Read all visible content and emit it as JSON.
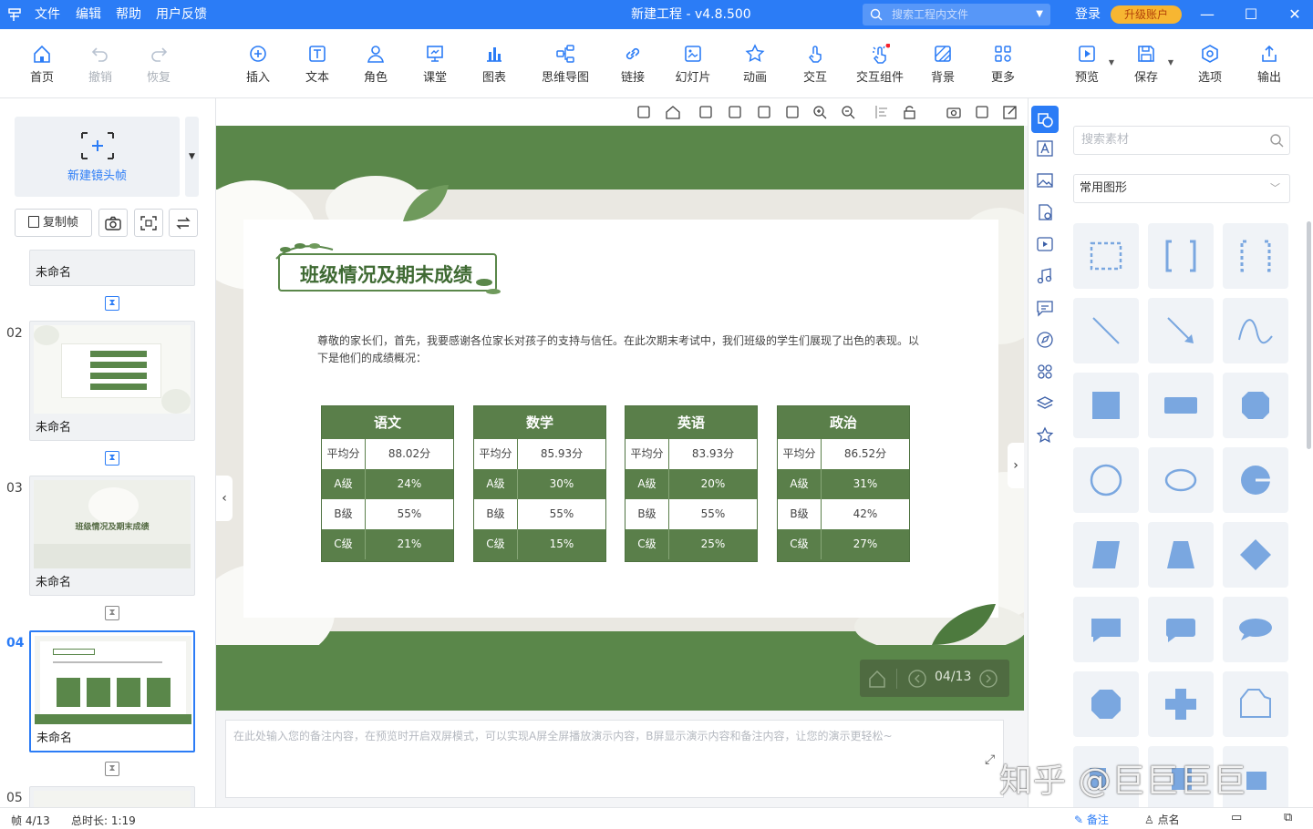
{
  "titlebar": {
    "app_icon": "app-logo-icon",
    "menus": [
      "文件",
      "编辑",
      "帮助",
      "用户反馈"
    ],
    "title": "新建工程 - v4.8.500",
    "search_placeholder": "搜索工程内文件",
    "login": "登录",
    "upgrade": "升级账户",
    "accent": "#2b7cf6"
  },
  "toolbar": {
    "items": [
      {
        "label": "首页",
        "icon": "home-icon",
        "enabled": true
      },
      {
        "label": "撤销",
        "icon": "undo-icon",
        "enabled": false
      },
      {
        "label": "恢复",
        "icon": "redo-icon",
        "enabled": false
      },
      {
        "label": "插入",
        "icon": "plus-circle-icon",
        "enabled": true
      },
      {
        "label": "文本",
        "icon": "text-icon",
        "enabled": true
      },
      {
        "label": "角色",
        "icon": "person-icon",
        "enabled": true
      },
      {
        "label": "课堂",
        "icon": "classroom-icon",
        "enabled": true
      },
      {
        "label": "图表",
        "icon": "bar-chart-icon",
        "enabled": true
      },
      {
        "label": "思维导图",
        "icon": "mindmap-icon",
        "enabled": true
      },
      {
        "label": "链接",
        "icon": "link-icon",
        "enabled": true
      },
      {
        "label": "幻灯片",
        "icon": "slides-icon",
        "enabled": true
      },
      {
        "label": "动画",
        "icon": "star-icon",
        "enabled": true
      },
      {
        "label": "交互",
        "icon": "tap-icon",
        "enabled": true
      },
      {
        "label": "交互组件",
        "icon": "interactive-component-icon",
        "enabled": true
      },
      {
        "label": "背景",
        "icon": "background-icon",
        "enabled": true
      },
      {
        "label": "更多",
        "icon": "grid-more-icon",
        "enabled": true
      },
      {
        "label": "预览",
        "icon": "preview-icon",
        "enabled": true
      },
      {
        "label": "保存",
        "icon": "save-icon",
        "enabled": true
      },
      {
        "label": "选项",
        "icon": "options-icon",
        "enabled": true
      },
      {
        "label": "输出",
        "icon": "export-icon",
        "enabled": true
      }
    ]
  },
  "leftpanel": {
    "new_frame": "新建镜头帧",
    "copy_frame": "复制帧",
    "slides": [
      {
        "num": "",
        "name": "未命名"
      },
      {
        "num": "02",
        "name": "未命名"
      },
      {
        "num": "03",
        "name": "未命名"
      },
      {
        "num": "04",
        "name": "未命名",
        "active": true
      },
      {
        "num": "05",
        "name": ""
      }
    ],
    "thumb3_title": "班级情况及期末成绩"
  },
  "slide": {
    "title": "班级情况及期末成绩",
    "intro": "尊敬的家长们，首先，我要感谢各位家长对孩子的支持与信任。在此次期末考试中，我们班级的学生们展现了出色的表现。以下是他们的成绩概况：",
    "green": "#5a874a",
    "tables": [
      {
        "subject": "语文",
        "rows": [
          [
            "平均分",
            "88.02分"
          ],
          [
            "A级",
            "24%"
          ],
          [
            "B级",
            "55%"
          ],
          [
            "C级",
            "21%"
          ]
        ]
      },
      {
        "subject": "数学",
        "rows": [
          [
            "平均分",
            "85.93分"
          ],
          [
            "A级",
            "30%"
          ],
          [
            "B级",
            "55%"
          ],
          [
            "C级",
            "15%"
          ]
        ]
      },
      {
        "subject": "英语",
        "rows": [
          [
            "平均分",
            "83.93分"
          ],
          [
            "A级",
            "20%"
          ],
          [
            "B级",
            "55%"
          ],
          [
            "C级",
            "25%"
          ]
        ]
      },
      {
        "subject": "政治",
        "rows": [
          [
            "平均分",
            "86.52分"
          ],
          [
            "A级",
            "31%"
          ],
          [
            "B级",
            "42%"
          ],
          [
            "C级",
            "27%"
          ]
        ]
      }
    ],
    "pager": "04/13"
  },
  "notes": {
    "placeholder": "在此处输入您的备注内容，在预览时开启双屏模式，可以实现A屏全屏播放演示内容，B屏显示演示内容和备注内容，让您的演示更轻松~"
  },
  "rightpanel": {
    "search_placeholder": "搜索素材",
    "category": "常用图形",
    "shapes": [
      "rect-dashed",
      "brackets",
      "brackets-dashed",
      "line",
      "arrow",
      "curve",
      "square",
      "rect",
      "octagon-rounded",
      "circle",
      "ellipse",
      "circle-cut",
      "parallelogram",
      "trapezoid",
      "diamond",
      "speech-rect",
      "speech-rounded",
      "speech-ellipse",
      "octagon",
      "cross",
      "freeform",
      "partial-a",
      "partial-b",
      "partial-c"
    ],
    "shape_color": "#7aa7e0"
  },
  "statusbar": {
    "frame": "帧 4/13",
    "duration": "总时长: 1:19",
    "notes": "备注",
    "rollcall": "点名"
  },
  "watermark": "知乎 @巨巨巨巨"
}
